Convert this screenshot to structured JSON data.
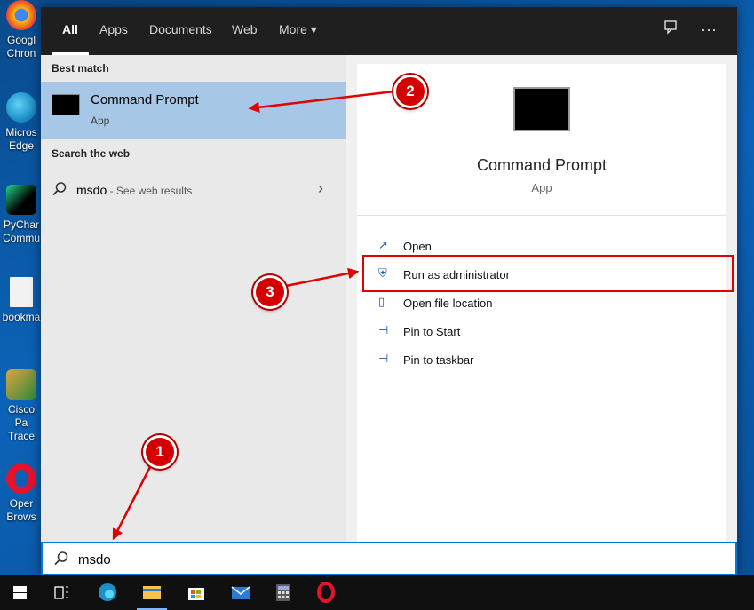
{
  "desktop": {
    "icons": [
      {
        "label": "Googl Chron",
        "color": "#fbbc05"
      },
      {
        "label": "Micros Edge",
        "color": "#1e90c8"
      },
      {
        "label": "PyChar Commu",
        "color": "#21d789"
      },
      {
        "label": "bookma",
        "color": "#f2f2f2"
      },
      {
        "label": "Cisco Pa Trace",
        "color": "#d9a441"
      },
      {
        "label": "Oper Brows",
        "color": "#e5122e"
      }
    ]
  },
  "tabs": [
    {
      "label": "All",
      "active": true
    },
    {
      "label": "Apps"
    },
    {
      "label": "Documents"
    },
    {
      "label": "Web"
    },
    {
      "label": "More ▾"
    }
  ],
  "top_actions": {
    "feedback_icon": "feedback-icon",
    "more_icon": "ellipsis-icon",
    "more_label": "···"
  },
  "left": {
    "best_match_title": "Best match",
    "best_match": {
      "title": "Command Prompt",
      "subtitle": "App"
    },
    "web_title": "Search the web",
    "web_query": "msdo",
    "web_hint": " - See web results",
    "chevron": "›"
  },
  "right": {
    "title": "Command Prompt",
    "subtitle": "App",
    "actions": [
      {
        "label": "Open",
        "icon": "open-icon",
        "glyph": "↗"
      },
      {
        "label": "Run as administrator",
        "icon": "shield-icon",
        "glyph": "⛨"
      },
      {
        "label": "Open file location",
        "icon": "file-location-icon",
        "glyph": "▯"
      },
      {
        "label": "Pin to Start",
        "icon": "pin-icon",
        "glyph": "⊣"
      },
      {
        "label": "Pin to taskbar",
        "icon": "pin-icon",
        "glyph": "⊣"
      }
    ]
  },
  "search": {
    "value": "msdo"
  },
  "taskbar": [
    {
      "name": "windows-start-icon"
    },
    {
      "name": "task-view-icon"
    },
    {
      "name": "edge-icon"
    },
    {
      "name": "file-explorer-icon"
    },
    {
      "name": "store-icon"
    },
    {
      "name": "mail-icon"
    },
    {
      "name": "calculator-icon"
    },
    {
      "name": "opera-icon"
    }
  ],
  "annotations": {
    "badge1": "1",
    "badge2": "2",
    "badge3": "3"
  },
  "colors": {
    "accent": "#0078d7",
    "annotation": "#d40000",
    "selection": "#a6c8e6"
  }
}
